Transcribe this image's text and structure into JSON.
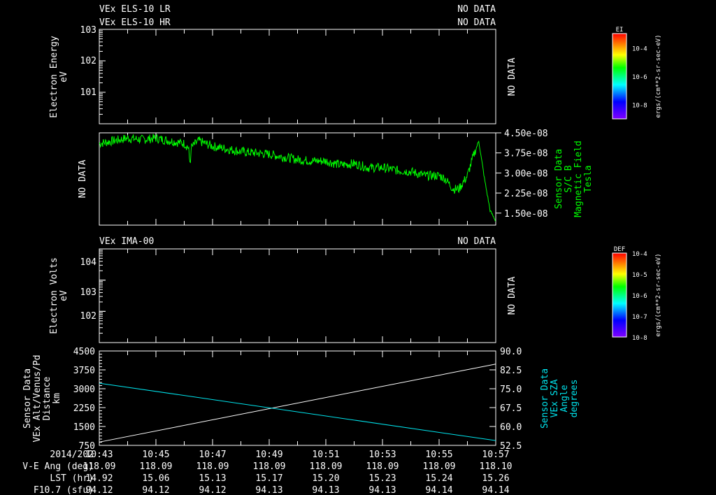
{
  "header": {
    "els_lr": "VEx ELS-10 LR",
    "els_hr": "VEx ELS-10 HR",
    "ima": "VEx IMA-00",
    "no_data": "NO DATA"
  },
  "colors": {
    "mag": "#00ff00",
    "sza": "#00e5ee",
    "alt": "#ffffff"
  },
  "chart_data": [
    {
      "type": "spectrogram",
      "title": "VEx ELS-10 LR / HR",
      "ylabel": "Electron Energy",
      "yunits": "eV",
      "yticks": [
        "10^3",
        "10^2",
        "10^1"
      ],
      "status": "NO DATA",
      "colorbar": {
        "label": "EI",
        "units": "ergs/(cm**2-sr-sec-eV)",
        "ticks": [
          "10^-4",
          "10^-6",
          "10^-8"
        ]
      }
    },
    {
      "type": "line",
      "ylabel": [
        "Sensor Data",
        "S/C B",
        "Magnetic Field",
        "Tesla"
      ],
      "left_status": "NO DATA",
      "yticks": [
        "4.50e-08",
        "3.75e-08",
        "3.00e-08",
        "2.25e-08",
        "1.50e-08"
      ],
      "ylim": [
        1.05e-08,
        4.5e-08
      ],
      "x_minutes_after_1043": [
        0,
        0.5,
        1,
        1.5,
        2,
        2.5,
        3,
        3.2,
        3.5,
        4,
        4.5,
        5,
        5.5,
        6,
        6.5,
        7,
        7.5,
        8,
        8.5,
        9,
        9.5,
        10,
        10.5,
        11,
        11.5,
        12,
        12.2,
        12.5,
        12.7,
        13,
        13.2,
        13.4,
        13.6,
        13.8,
        14
      ],
      "values": [
        4.1e-08,
        4.2e-08,
        4.3e-08,
        4.25e-08,
        4.3e-08,
        4.2e-08,
        4.1e-08,
        3.9e-08,
        4.2e-08,
        4e-08,
        3.9e-08,
        3.8e-08,
        3.75e-08,
        3.7e-08,
        3.6e-08,
        3.5e-08,
        3.45e-08,
        3.45e-08,
        3.3e-08,
        3.35e-08,
        3.2e-08,
        3.2e-08,
        3.1e-08,
        3.05e-08,
        2.9e-08,
        2.9e-08,
        2.8e-08,
        2.4e-08,
        2.4e-08,
        2.9e-08,
        3.6e-08,
        4.2e-08,
        2.8e-08,
        1.6e-08,
        1.2e-08
      ]
    },
    {
      "type": "spectrogram",
      "title": "VEx IMA-00",
      "ylabel": "Electron Volts",
      "yunits": "eV",
      "yticks": [
        "10^4",
        "10^3",
        "10^2"
      ],
      "status": "NO DATA",
      "colorbar": {
        "label": "DEF",
        "units": "ergs/(cm**2-sr-sec-eV)",
        "ticks": [
          "10^-4",
          "10^-5",
          "10^-6",
          "10^-7",
          "10^-8"
        ]
      }
    },
    {
      "type": "line",
      "ylabel_left": [
        "Sensor Data",
        "VEx Alt/Venus/Pd",
        "Distance",
        "km"
      ],
      "ylabel_right": [
        "Sensor Data",
        "VEx SZA",
        "Angle",
        "degrees"
      ],
      "yticks_left": [
        "4500",
        "3750",
        "3000",
        "2250",
        "1500",
        "750"
      ],
      "ylim_left": [
        750,
        4500
      ],
      "yticks_right": [
        "90.0",
        "82.5",
        "75.0",
        "67.5",
        "60.0",
        "52.5"
      ],
      "ylim_right": [
        52.5,
        90
      ],
      "series": [
        {
          "name": "Altitude",
          "axis": "left",
          "x": [
            0,
            14
          ],
          "values": [
            880,
            3980
          ]
        },
        {
          "name": "SZA",
          "axis": "right",
          "x": [
            0,
            14
          ],
          "values": [
            77.2,
            54.4
          ]
        }
      ]
    }
  ],
  "xaxis": {
    "row_labels": [
      "2014/202",
      "V-E Ang (deg)",
      "LST (hr)",
      "F10.7 (sfu)"
    ],
    "times": [
      "10:43",
      "10:45",
      "10:47",
      "10:49",
      "10:51",
      "10:53",
      "10:55",
      "10:57"
    ],
    "ve_ang": [
      "118.09",
      "118.09",
      "118.09",
      "118.09",
      "118.09",
      "118.09",
      "118.09",
      "118.10"
    ],
    "lst": [
      "14.92",
      "15.06",
      "15.13",
      "15.17",
      "15.20",
      "15.23",
      "15.24",
      "15.26"
    ],
    "f107": [
      "94.12",
      "94.12",
      "94.12",
      "94.13",
      "94.13",
      "94.13",
      "94.14",
      "94.14"
    ]
  }
}
